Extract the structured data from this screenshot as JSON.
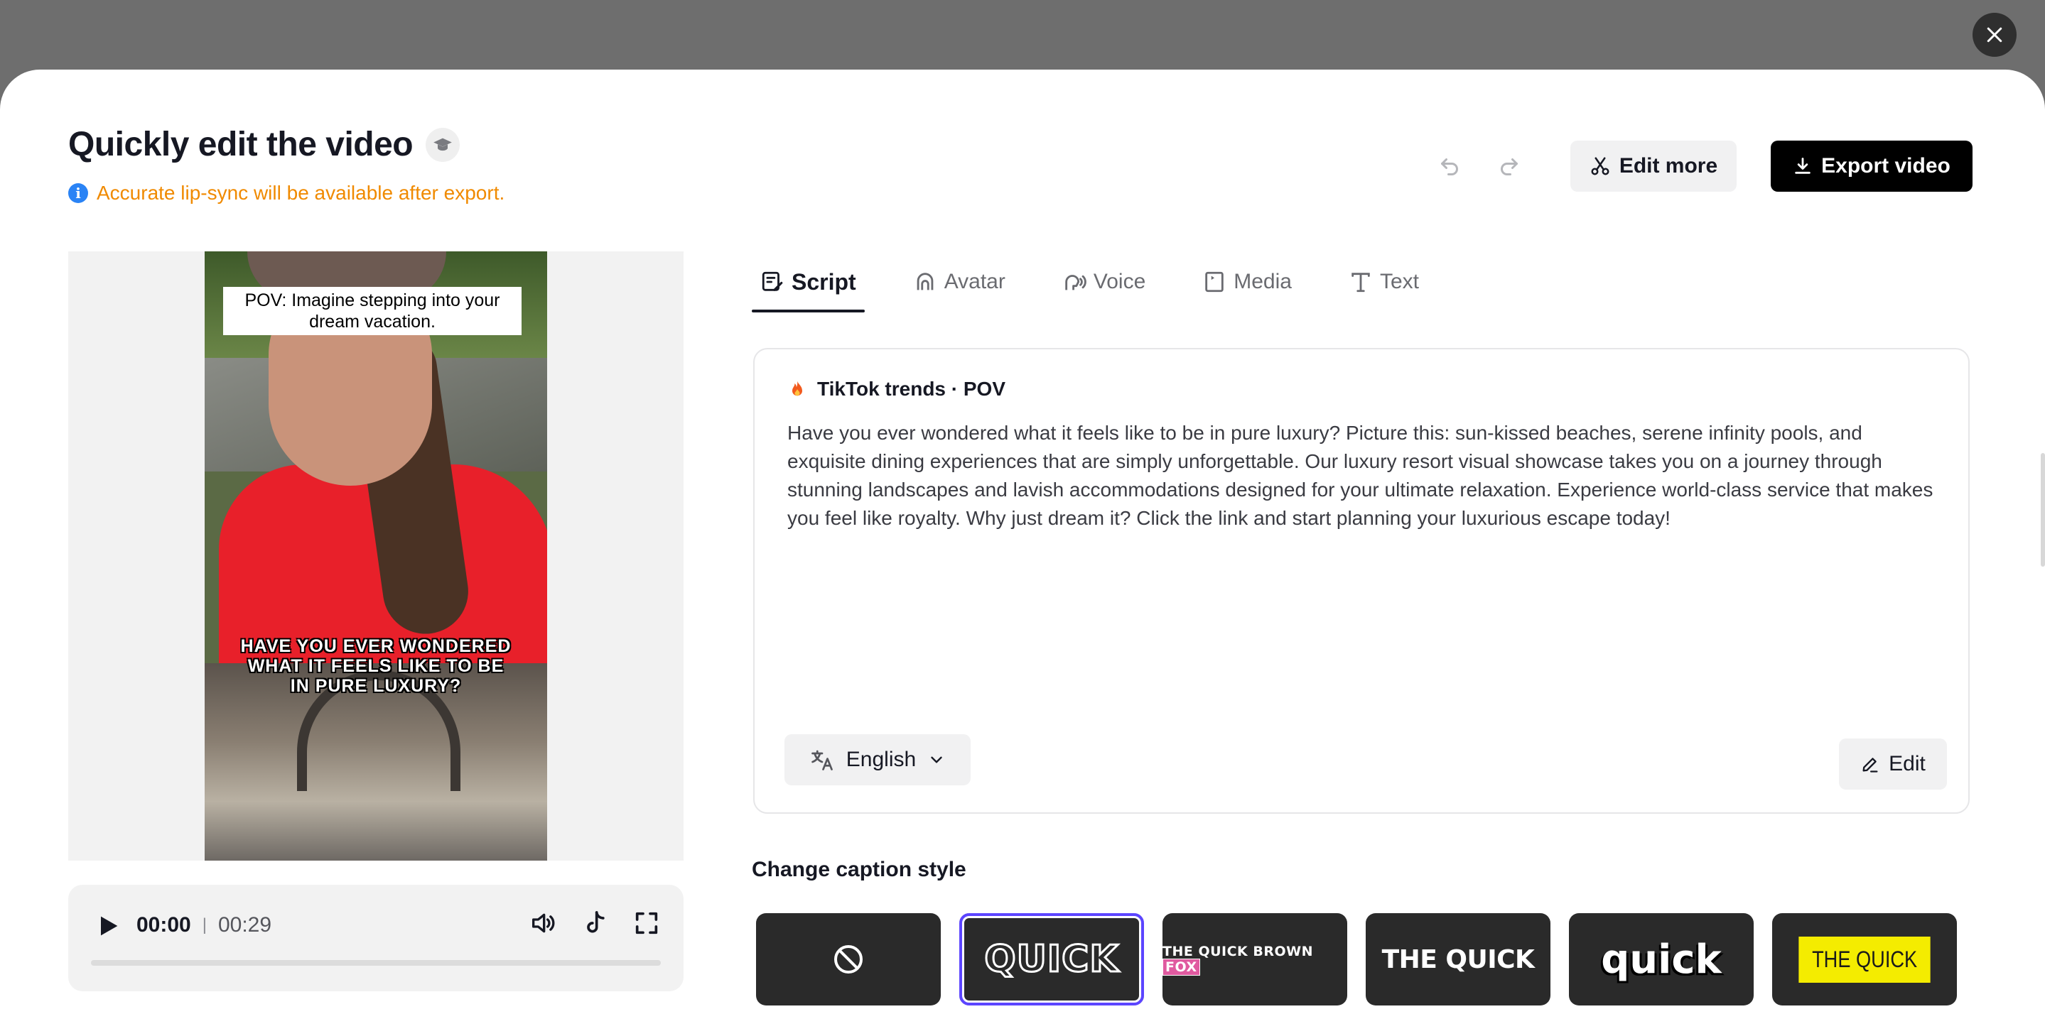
{
  "modal": {
    "title": "Quickly edit the video",
    "notice": "Accurate lip-sync will be available after export."
  },
  "toolbar": {
    "edit_more_label": "Edit more",
    "export_label": "Export video"
  },
  "preview": {
    "caption_top_line1": "POV: Imagine stepping into your",
    "caption_top_line2": "dream vacation.",
    "caption_bottom_line1": "HAVE YOU EVER WONDERED",
    "caption_bottom_line2": "WHAT IT FEELS LIKE TO BE",
    "caption_bottom_line3": "IN PURE LUXURY?"
  },
  "player": {
    "current_time": "00:00",
    "separator": "|",
    "duration": "00:29",
    "progress": 0
  },
  "tabs": [
    {
      "label": "Script",
      "active": true
    },
    {
      "label": "Avatar",
      "active": false
    },
    {
      "label": "Voice",
      "active": false
    },
    {
      "label": "Media",
      "active": false
    },
    {
      "label": "Text",
      "active": false
    }
  ],
  "script": {
    "trend_label": "TikTok trends · POV",
    "text": "Have you ever wondered what it feels like to be in pure luxury? Picture this: sun-kissed beaches, serene infinity pools, and exquisite dining experiences that are simply unforgettable. Our luxury resort visual showcase takes you on a journey through stunning landscapes and lavish accommodations designed for your ultimate relaxation. Experience world-class service that makes you feel like royalty. Why just dream it? Click the link and start planning your luxurious escape today!",
    "language": "English",
    "edit_label": "Edit"
  },
  "captions": {
    "heading": "Change caption style",
    "styles": [
      {
        "label": "",
        "selected": false
      },
      {
        "label": "QUICK",
        "selected": true
      },
      {
        "label": "THE QUICK BROWN",
        "label2": "FOX",
        "selected": false
      },
      {
        "label": "THE QUICK",
        "selected": false
      },
      {
        "label": "quick",
        "selected": false
      },
      {
        "label": "THE QUICK",
        "selected": false
      }
    ]
  },
  "colors": {
    "accent_selected": "#5c45ff",
    "notice": "#f08a00",
    "info": "#2a83f5"
  }
}
